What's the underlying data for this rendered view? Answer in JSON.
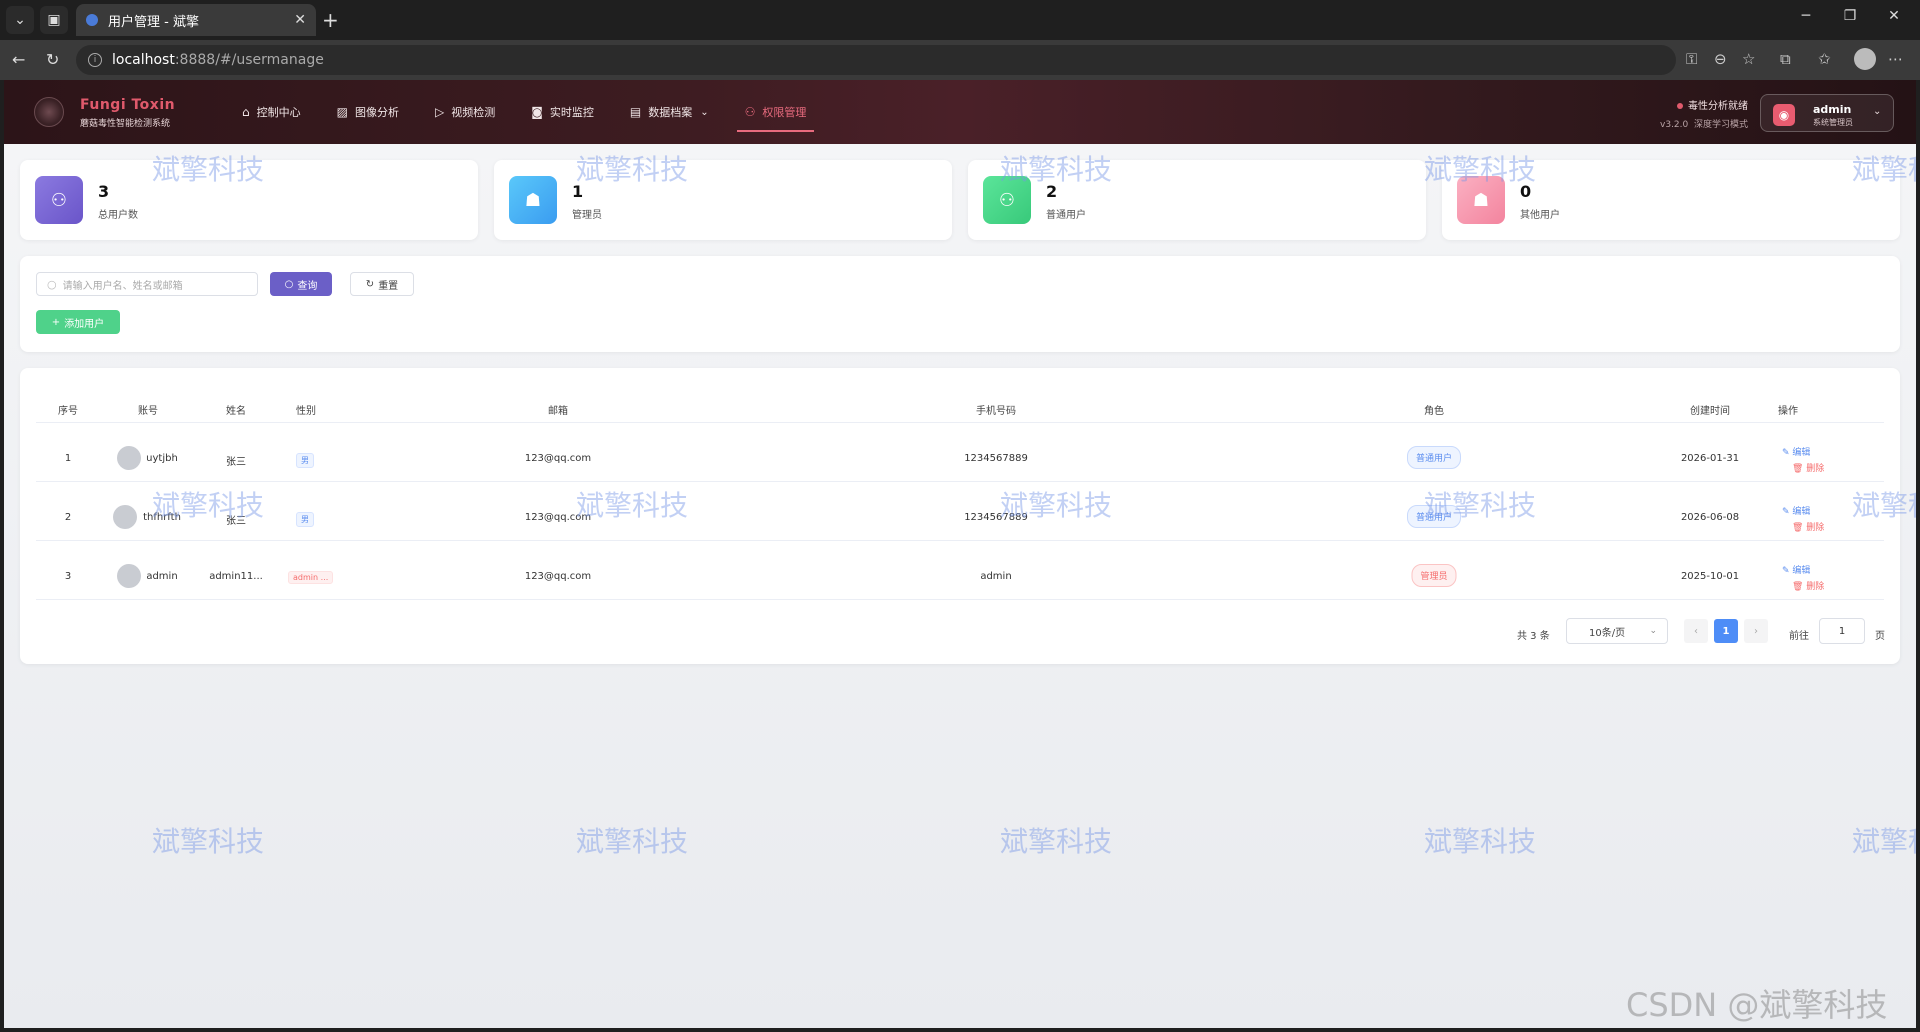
{
  "browser": {
    "tab_title": "用户管理 - 斌擎",
    "url_host": "localhost",
    "url_path": ":8888/#/usermanage",
    "close_glyph": "✕",
    "newtab_glyph": "+",
    "win_minimize": "─",
    "win_restore": "❐",
    "win_close": "✕"
  },
  "app": {
    "brand_title": "Fungi Toxin",
    "brand_subtitle": "蘑菇毒性智能检测系统",
    "nav": [
      {
        "label": "控制中心",
        "icon": "home-icon"
      },
      {
        "label": "图像分析",
        "icon": "image-icon"
      },
      {
        "label": "视频检测",
        "icon": "play-icon"
      },
      {
        "label": "实时监控",
        "icon": "camera-icon"
      },
      {
        "label": "数据档案",
        "icon": "document-icon"
      },
      {
        "label": "权限管理",
        "icon": "user-icon"
      }
    ],
    "active_nav": "权限管理",
    "status_text": "毒性分析就绪",
    "version": "v3.2.0",
    "mode": "深度学习模式",
    "user_name": "admin",
    "user_role": "系统管理员"
  },
  "stats": [
    {
      "value": "3",
      "label": "总用户数",
      "color": "#7b68d6"
    },
    {
      "value": "1",
      "label": "管理员",
      "color": "#3fb5f5"
    },
    {
      "value": "2",
      "label": "普通用户",
      "color": "#4fd28a"
    },
    {
      "value": "0",
      "label": "其他用户",
      "color": "#f591aa"
    }
  ],
  "toolbar": {
    "search_placeholder": "请输入用户名、姓名或邮箱",
    "query_label": "查询",
    "reset_label": "重置",
    "add_label": "添加用户",
    "query_color": "#6b5fc7",
    "add_color": "#4fd28a"
  },
  "table": {
    "columns": [
      "序号",
      "账号",
      "姓名",
      "性别",
      "邮箱",
      "手机号码",
      "角色",
      "创建时间",
      "操作"
    ],
    "rows": [
      {
        "index": "1",
        "account": "uytjbh",
        "name": "张三",
        "gender": "男",
        "email": "123@qq.com",
        "phone": "1234567889",
        "role": "普通用户",
        "created": "2026-01-31"
      },
      {
        "index": "2",
        "account": "thfhrfth",
        "name": "张三",
        "gender": "男",
        "email": "123@qq.com",
        "phone": "1234567889",
        "role": "普通用户",
        "created": "2026-06-08"
      },
      {
        "index": "3",
        "account": "admin",
        "name": "admin11...",
        "gender": "admin ...",
        "email": "123@qq.com",
        "phone": "admin",
        "role": "管理员",
        "created": "2025-10-01"
      }
    ],
    "edit_label": "编辑",
    "delete_label": "删除"
  },
  "pagination": {
    "total": "共 3 条",
    "page_size": "10条/页",
    "current_page": "1",
    "goto_label": "前往",
    "goto_value": "1",
    "page_unit": "页"
  },
  "watermark": "斌擎科技",
  "csdn_watermark": "CSDN @斌擎科技"
}
